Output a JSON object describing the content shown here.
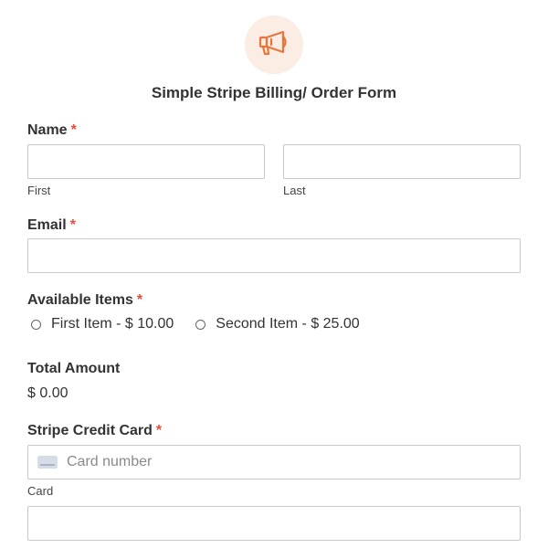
{
  "header": {
    "icon": "megaphone-icon",
    "accent_color": "#e8763a",
    "icon_bg": "#fbece4",
    "title": "Simple Stripe Billing/ Order Form"
  },
  "fields": {
    "name": {
      "label": "Name",
      "required_mark": "*",
      "first_sublabel": "First",
      "last_sublabel": "Last",
      "first_value": "",
      "last_value": ""
    },
    "email": {
      "label": "Email",
      "required_mark": "*",
      "value": ""
    },
    "items": {
      "label": "Available Items",
      "required_mark": "*",
      "options": [
        {
          "label": "First Item - $ 10.00",
          "selected": false
        },
        {
          "label": "Second Item - $ 25.00",
          "selected": false
        }
      ]
    },
    "total": {
      "label": "Total Amount",
      "value": "$ 0.00"
    },
    "card": {
      "label": "Stripe Credit Card",
      "required_mark": "*",
      "placeholder": "Card number",
      "sublabel": "Card",
      "icon": "credit-card-icon"
    }
  },
  "colors": {
    "required": "#e74c3c",
    "border": "#c8c8c8",
    "text": "#333333"
  }
}
